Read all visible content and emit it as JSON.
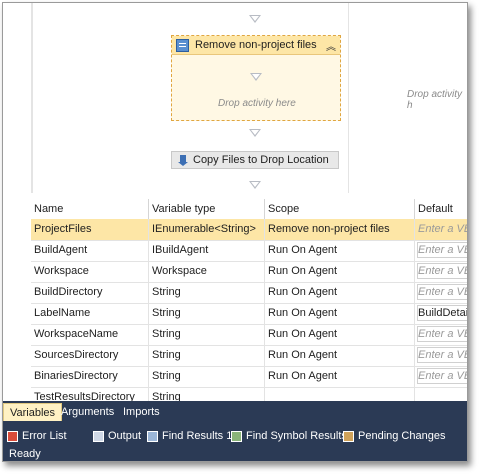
{
  "designer": {
    "activity_title": "Remove non-project files",
    "drop_text_inner": "Drop activity here",
    "drop_text_right": "Drop activity h",
    "copy_activity": "Copy Files to Drop Location"
  },
  "grid": {
    "headers": [
      "Name",
      "Variable type",
      "Scope",
      "Default"
    ],
    "rows": [
      {
        "name": "ProjectFiles",
        "type": "IEnumerable<String>",
        "scope": "Remove non-project files",
        "default": "Enter a VB",
        "selected": true
      },
      {
        "name": "BuildAgent",
        "type": "IBuildAgent",
        "scope": "Run On Agent",
        "default": "Enter a VB"
      },
      {
        "name": "Workspace",
        "type": "Workspace",
        "scope": "Run On Agent",
        "default": "Enter a VB"
      },
      {
        "name": "BuildDirectory",
        "type": "String",
        "scope": "Run On Agent",
        "default": "Enter a VB"
      },
      {
        "name": "LabelName",
        "type": "String",
        "scope": "Run On Agent",
        "default": "BuildDetail."
      },
      {
        "name": "WorkspaceName",
        "type": "String",
        "scope": "Run On Agent",
        "default": "Enter a VB"
      },
      {
        "name": "SourcesDirectory",
        "type": "String",
        "scope": "Run On Agent",
        "default": "Enter a VB"
      },
      {
        "name": "BinariesDirectory",
        "type": "String",
        "scope": "Run On Agent",
        "default": "Enter a VB"
      },
      {
        "name": "TestResultsDirectory",
        "type": "String",
        "scope": "",
        "default": ""
      }
    ]
  },
  "tabs": [
    "Variables",
    "Arguments",
    "Imports"
  ],
  "toolstrip": [
    {
      "label": "Error List",
      "icon": "error-list-icon"
    },
    {
      "label": "Output",
      "icon": "output-icon"
    },
    {
      "label": "Find Results 1",
      "icon": "find-results-icon"
    },
    {
      "label": "Find Symbol Results",
      "icon": "find-symbol-icon"
    },
    {
      "label": "Pending Changes",
      "icon": "pending-changes-icon"
    }
  ],
  "status": "Ready"
}
